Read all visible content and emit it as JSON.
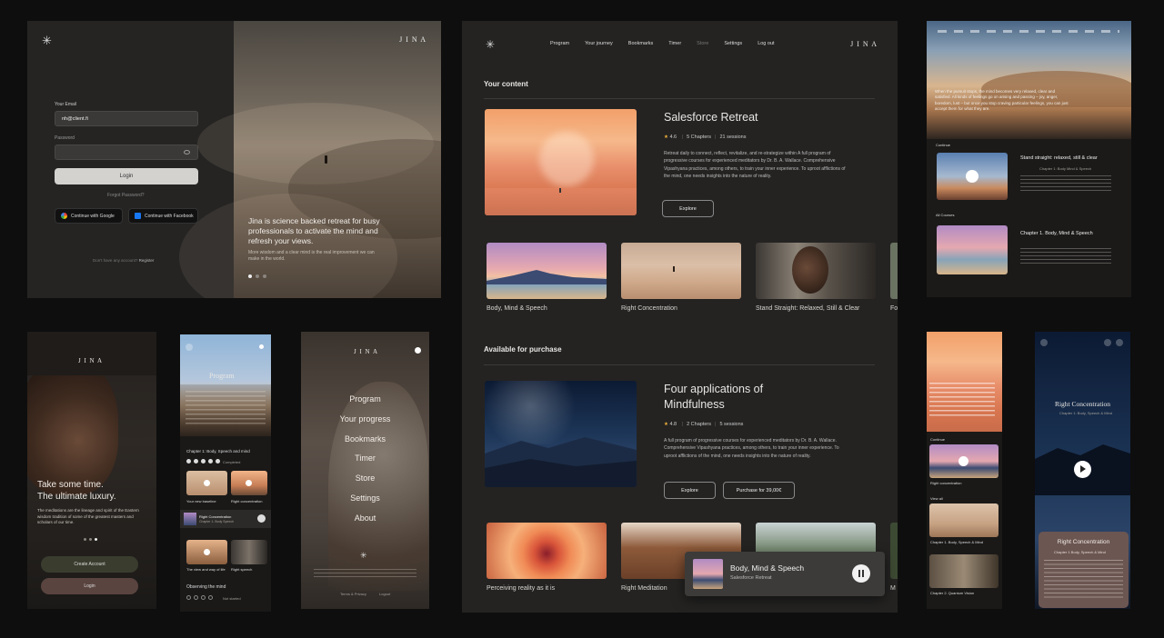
{
  "login": {
    "logo": "✳",
    "brand": "J I N A",
    "email_label": "Your Email",
    "email_value": "nh@client.fi",
    "password_label": "Password",
    "login_button": "Login",
    "forgot": "Forgot Password?",
    "google": "Continue with Google",
    "facebook": "Continue with Facebook",
    "no_account": "Don't have any account?",
    "register": "Register",
    "tagline": "Jina is science backed retreat for busy professionals to activate the mind and refresh your views.",
    "tagline_sub": "More wisdom and a clear mind is the real improvement we can make in the world."
  },
  "main": {
    "logo": "✳",
    "brand": "J I N A",
    "nav": [
      "Program",
      "Your journey",
      "Bookmarks",
      "Timer",
      "Store",
      "Settings",
      "Log out"
    ],
    "your_content": "Your content",
    "featured": {
      "title": "Salesforce Retreat",
      "rating": "4.6",
      "chapters": "5 Chapters",
      "sessions": "21 sessions",
      "desc": "Retreat daily to connect, reflect, revitalize, and re-strategize within A full program of progressive courses for experienced meditators by Dr. B. A. Wallace. Comprehensive Vipashyana practices, among others, to train your inner experience. To uproot afflictions of the mind, one needs insights into the nature of reality.",
      "explore": "Explore"
    },
    "row1": [
      "Body, Mind & Speech",
      "Right Concentration",
      "Stand Straight: Relaxed, Still & Clear",
      "Fo"
    ],
    "available": "Available for purchase",
    "featured2": {
      "title": "Four applications of Mindfulness",
      "rating": "4.8",
      "chapters": "2 Chapters",
      "sessions": "5 sessions",
      "desc": "A full program of progressive courses for experienced meditators by Dr. B. A. Wallace. Comprehensive Vipashyana practices, among others, to train your inner experience. To uproot afflictions of the mind, one needs insights into the nature of reality.",
      "explore": "Explore",
      "purchase": "Purchase for 39,00€"
    },
    "row2": [
      "Perceiving reality as it is",
      "Right Meditation",
      "M"
    ],
    "player": {
      "title": "Body, Mind & Speech",
      "subtitle": "Salesforce Retreat"
    }
  },
  "mob1": {
    "brand": "J I N A",
    "headline1": "Take some time.",
    "headline2": "The ultimate luxury.",
    "text": "The meditations are the lineage and spirit of the Eastern wisdom tradition of some of the greatest masters and scholars of our time.",
    "create": "Create Account",
    "login": "Login"
  },
  "mob2": {
    "title": "Program",
    "chapter": "Chapter 1: Body, Speech and mind",
    "completed": "Completed",
    "item1": "Your new baseline",
    "item2": "Right concentration",
    "current": "Right Concentration",
    "current_sub": "Chapter 1: Body Speech",
    "item3": "The view and way of life",
    "item4": "Right speech",
    "observing": "Observing the mind",
    "not_started": "Not started"
  },
  "mob3": {
    "brand": "J I N A",
    "menu": [
      "Program",
      "Your progress",
      "Bookmarks",
      "Timer",
      "Store",
      "Settings",
      "About"
    ],
    "terms": "Terms & Privacy",
    "logout": "Logout"
  },
  "right1": {
    "quote": "When the pursuit stops, the mind becomes very relaxed, clear and satisfied. All kinds of feelings go on arising and passing – joy, anger, boredom, lust – but once you stop craving particular feelings, you can just accept them for what they are.",
    "continue": "Continue",
    "item_title": "Stand straight: relaxed, still & clear",
    "item_tag": "Chapter 1: Body Mind & Speech",
    "all_courses": "All Courses",
    "course_title": "Chapter 1. Body, Mind & Speech"
  },
  "right2": {
    "continue": "Continue",
    "item": "Right concentration",
    "view_all": "View all",
    "course1": "Chapter 1. Body, Speech & Mind",
    "course2": "Chapter 2. Quantum Vision"
  },
  "right3": {
    "title": "Right Concentration",
    "subtitle": "Chapter 1: Body, Speech & Mind",
    "card_title": "Right Concentration",
    "card_sub": "Chapter 1 Body, Speech & Mind"
  }
}
